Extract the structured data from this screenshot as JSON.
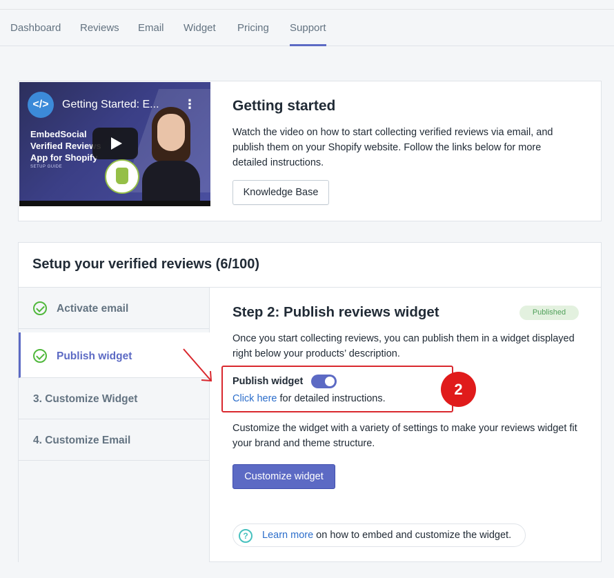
{
  "nav": {
    "items": [
      "Dashboard",
      "Reviews",
      "Email",
      "Widget",
      "Pricing",
      "Support"
    ],
    "active": "Support"
  },
  "getting_started": {
    "video": {
      "title": "Getting Started: E...",
      "brand_lines": [
        "EmbedSocial",
        "Verified Reviews",
        "App for Shopify"
      ],
      "subtitle": "SETUP GUIDE"
    },
    "title": "Getting started",
    "description": "Watch the video on how to start collecting verified reviews via email, and publish them on your Shopify website. Follow the links below for more detailed instructions.",
    "button_label": "Knowledge Base"
  },
  "setup": {
    "title": "Setup your verified reviews (6/100)",
    "steps": [
      {
        "label": "Activate email",
        "done": true
      },
      {
        "label": "Publish widget",
        "done": true,
        "active": true
      },
      {
        "label": "3.  Customize Widget",
        "done": false
      },
      {
        "label": "4.  Customize Email",
        "done": false
      }
    ],
    "main": {
      "title": "Step 2: Publish reviews widget",
      "badge": "Published",
      "description": "Once you start collecting reviews, you can publish them in a widget displayed right below your products’ description.",
      "toggle_label": "Publish widget",
      "toggle_on": true,
      "click_link": "Click here",
      "click_rest": " for detailed instructions.",
      "annotation_number": "2",
      "description2": "Customize the widget with a variety of settings to make your reviews widget fit your brand and theme structure.",
      "button_label": "Customize widget",
      "help_link": "Learn more",
      "help_rest": " on how to embed and customize the widget."
    }
  },
  "colors": {
    "accent": "#5c6ac4",
    "success": "#50b83c",
    "annotation_red": "#e01b1b",
    "link": "#2c6ecb"
  }
}
